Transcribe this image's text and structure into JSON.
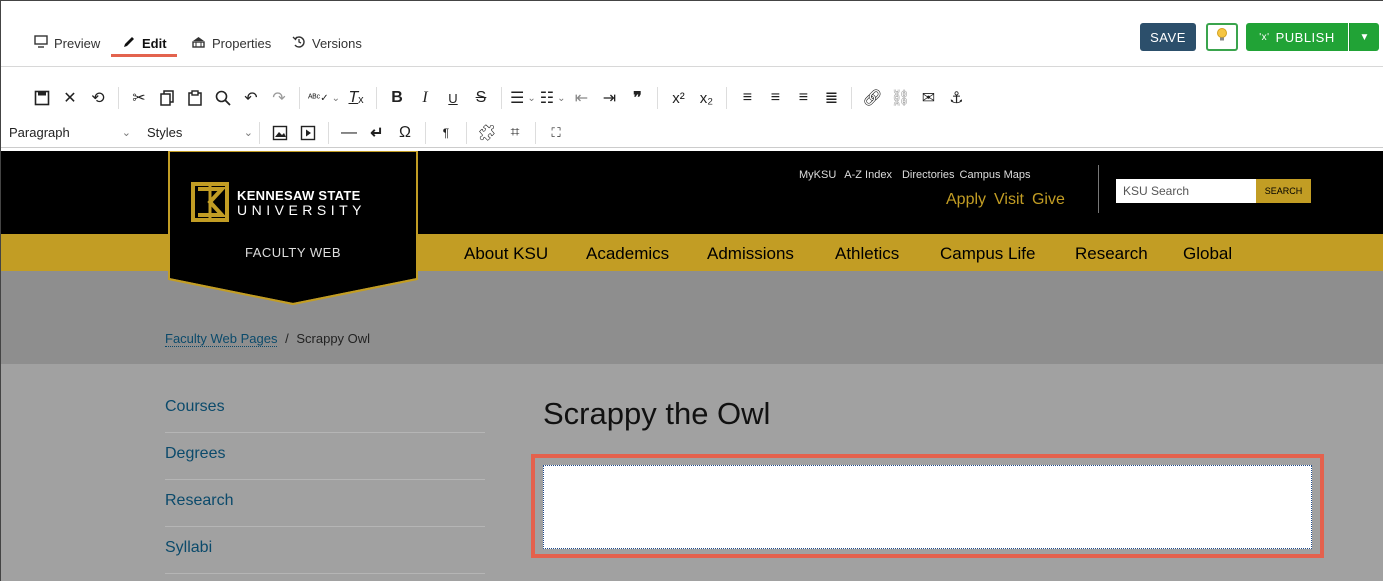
{
  "cms": {
    "tabs": [
      {
        "label": "Preview",
        "icon": "monitor-icon"
      },
      {
        "label": "Edit",
        "icon": "pencil-icon"
      },
      {
        "label": "Properties",
        "icon": "properties-icon"
      },
      {
        "label": "Versions",
        "icon": "history-icon"
      }
    ],
    "save_label": "SAVE",
    "publish_label": "PUBLISH",
    "accent_color": "#e3634e",
    "publish_color": "#21a336",
    "save_color": "#2c4f6b"
  },
  "toolbar": {
    "format_select": "Paragraph",
    "styles_select": "Styles"
  },
  "site": {
    "university_line1": "KENNESAW STATE",
    "university_line2": "UNIVERSITY",
    "faculty_web": "FACULTY WEB",
    "utility_links": [
      "MyKSU",
      "A-Z Index",
      "Directories",
      "Campus Maps"
    ],
    "cta_links": [
      "Apply",
      "Visit",
      "Give"
    ],
    "search_placeholder": "KSU Search",
    "search_button": "SEARCH",
    "nav": [
      "About KSU",
      "Academics",
      "Admissions",
      "Athletics",
      "Campus Life",
      "Research",
      "Global"
    ],
    "breadcrumb_link": "Faculty Web Pages",
    "breadcrumb_sep": "/",
    "breadcrumb_current": "Scrappy Owl",
    "sidebar": [
      "Courses",
      "Degrees",
      "Research",
      "Syllabi"
    ],
    "page_title": "Scrappy the Owl",
    "gold": "#c29d24"
  }
}
